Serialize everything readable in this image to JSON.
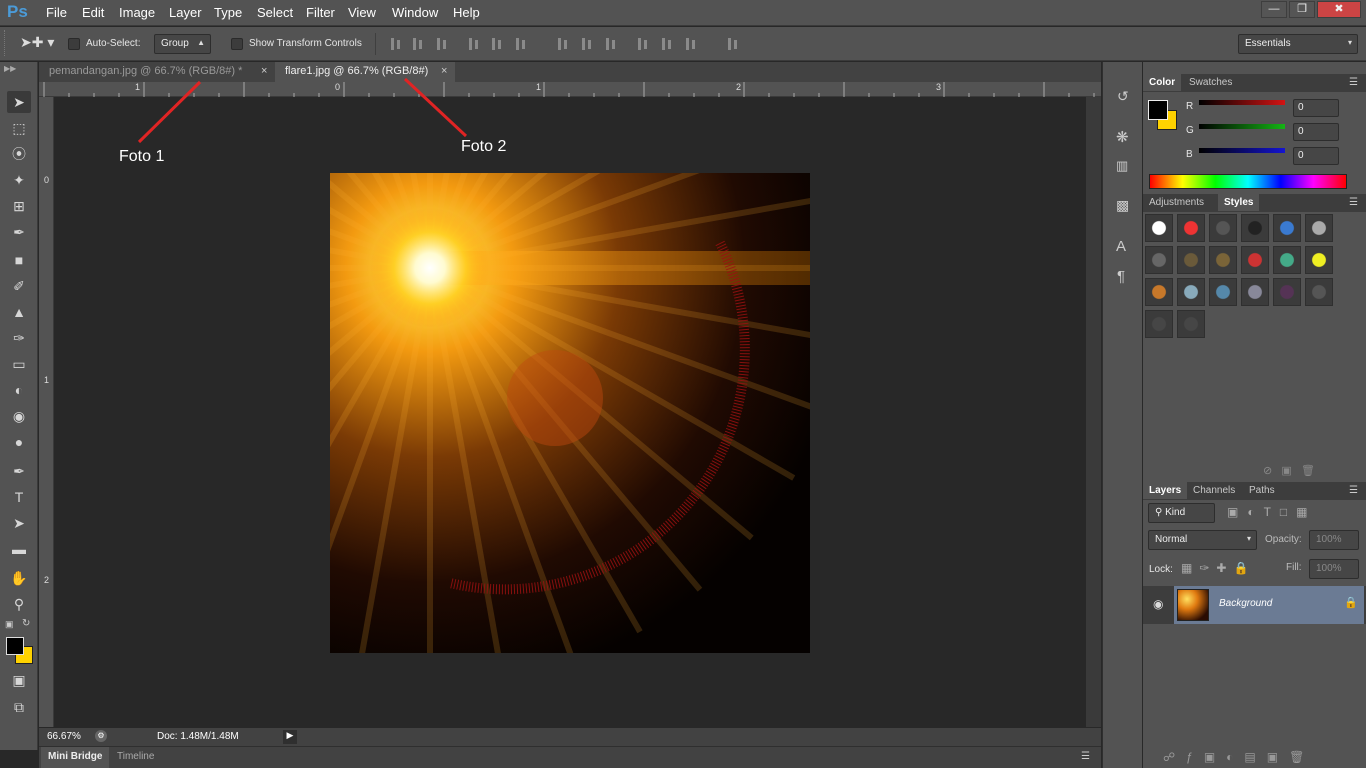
{
  "app": {
    "logo": "Ps"
  },
  "menu": [
    "File",
    "Edit",
    "Image",
    "Layer",
    "Type",
    "Select",
    "Filter",
    "View",
    "Window",
    "Help"
  ],
  "window_controls": {
    "minimize": "—",
    "restore": "❐",
    "close": "✖"
  },
  "options": {
    "auto_select_label": "Auto-Select:",
    "auto_select_value": "Group",
    "show_transform_label": "Show Transform Controls",
    "workspace": "Essentials"
  },
  "tabs": [
    {
      "label": "pemandangan.jpg @ 66.7% (RGB/8#) *",
      "active": false
    },
    {
      "label": "flare1.jpg @ 66.7% (RGB/8#)",
      "active": true
    }
  ],
  "ruler_h_labels": [
    "1",
    "0",
    "1",
    "2",
    "3"
  ],
  "ruler_v_labels": [
    "0",
    "1",
    "2"
  ],
  "annotations": {
    "foto1": "Foto 1",
    "foto2": "Foto 2",
    "arrow_color": "#e02424"
  },
  "status": {
    "zoom": "66.67%",
    "doc": "Doc: 1.48M/1.48M"
  },
  "bottom_tabs": [
    "Mini Bridge",
    "Timeline"
  ],
  "color_panel": {
    "tabs": [
      "Color",
      "Swatches"
    ],
    "sliders": [
      {
        "label": "R",
        "value": "0",
        "color": "#d31313"
      },
      {
        "label": "G",
        "value": "0",
        "color": "#14b414"
      },
      {
        "label": "B",
        "value": "0",
        "color": "#1414d2"
      }
    ],
    "foreground": "#000000",
    "background": "#ffd200"
  },
  "styles_panel": {
    "tabs": [
      "Adjustments",
      "Styles"
    ]
  },
  "layers_panel": {
    "tabs": [
      "Layers",
      "Channels",
      "Paths"
    ],
    "kind": "Kind",
    "blend_mode": "Normal",
    "opacity_label": "Opacity:",
    "opacity_value": "100%",
    "lock_label": "Lock:",
    "fill_label": "Fill:",
    "fill_value": "100%",
    "layer_name": "Background"
  }
}
